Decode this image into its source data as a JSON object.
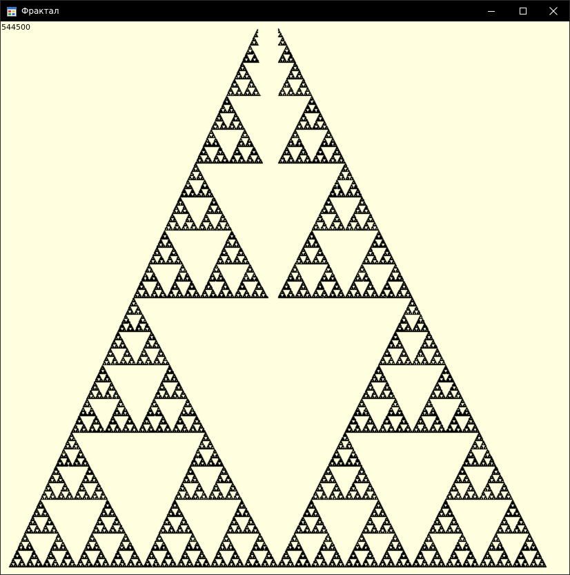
{
  "window": {
    "title": "Фрактал",
    "app_icon": "form-app-icon",
    "controls": {
      "minimize_icon": "minimize-icon",
      "maximize_icon": "maximize-icon",
      "close_icon": "close-icon"
    }
  },
  "client": {
    "counter_text": "544500",
    "fractal": {
      "type": "chaos-game-triangle",
      "points_plotted": 544500,
      "point_color": "#000000",
      "background_color": "#ffffe0"
    }
  },
  "colors": {
    "titlebar": "#000000",
    "titlebar_text": "#ffffff",
    "client_background": "#ffffe0",
    "ink": "#000000"
  }
}
